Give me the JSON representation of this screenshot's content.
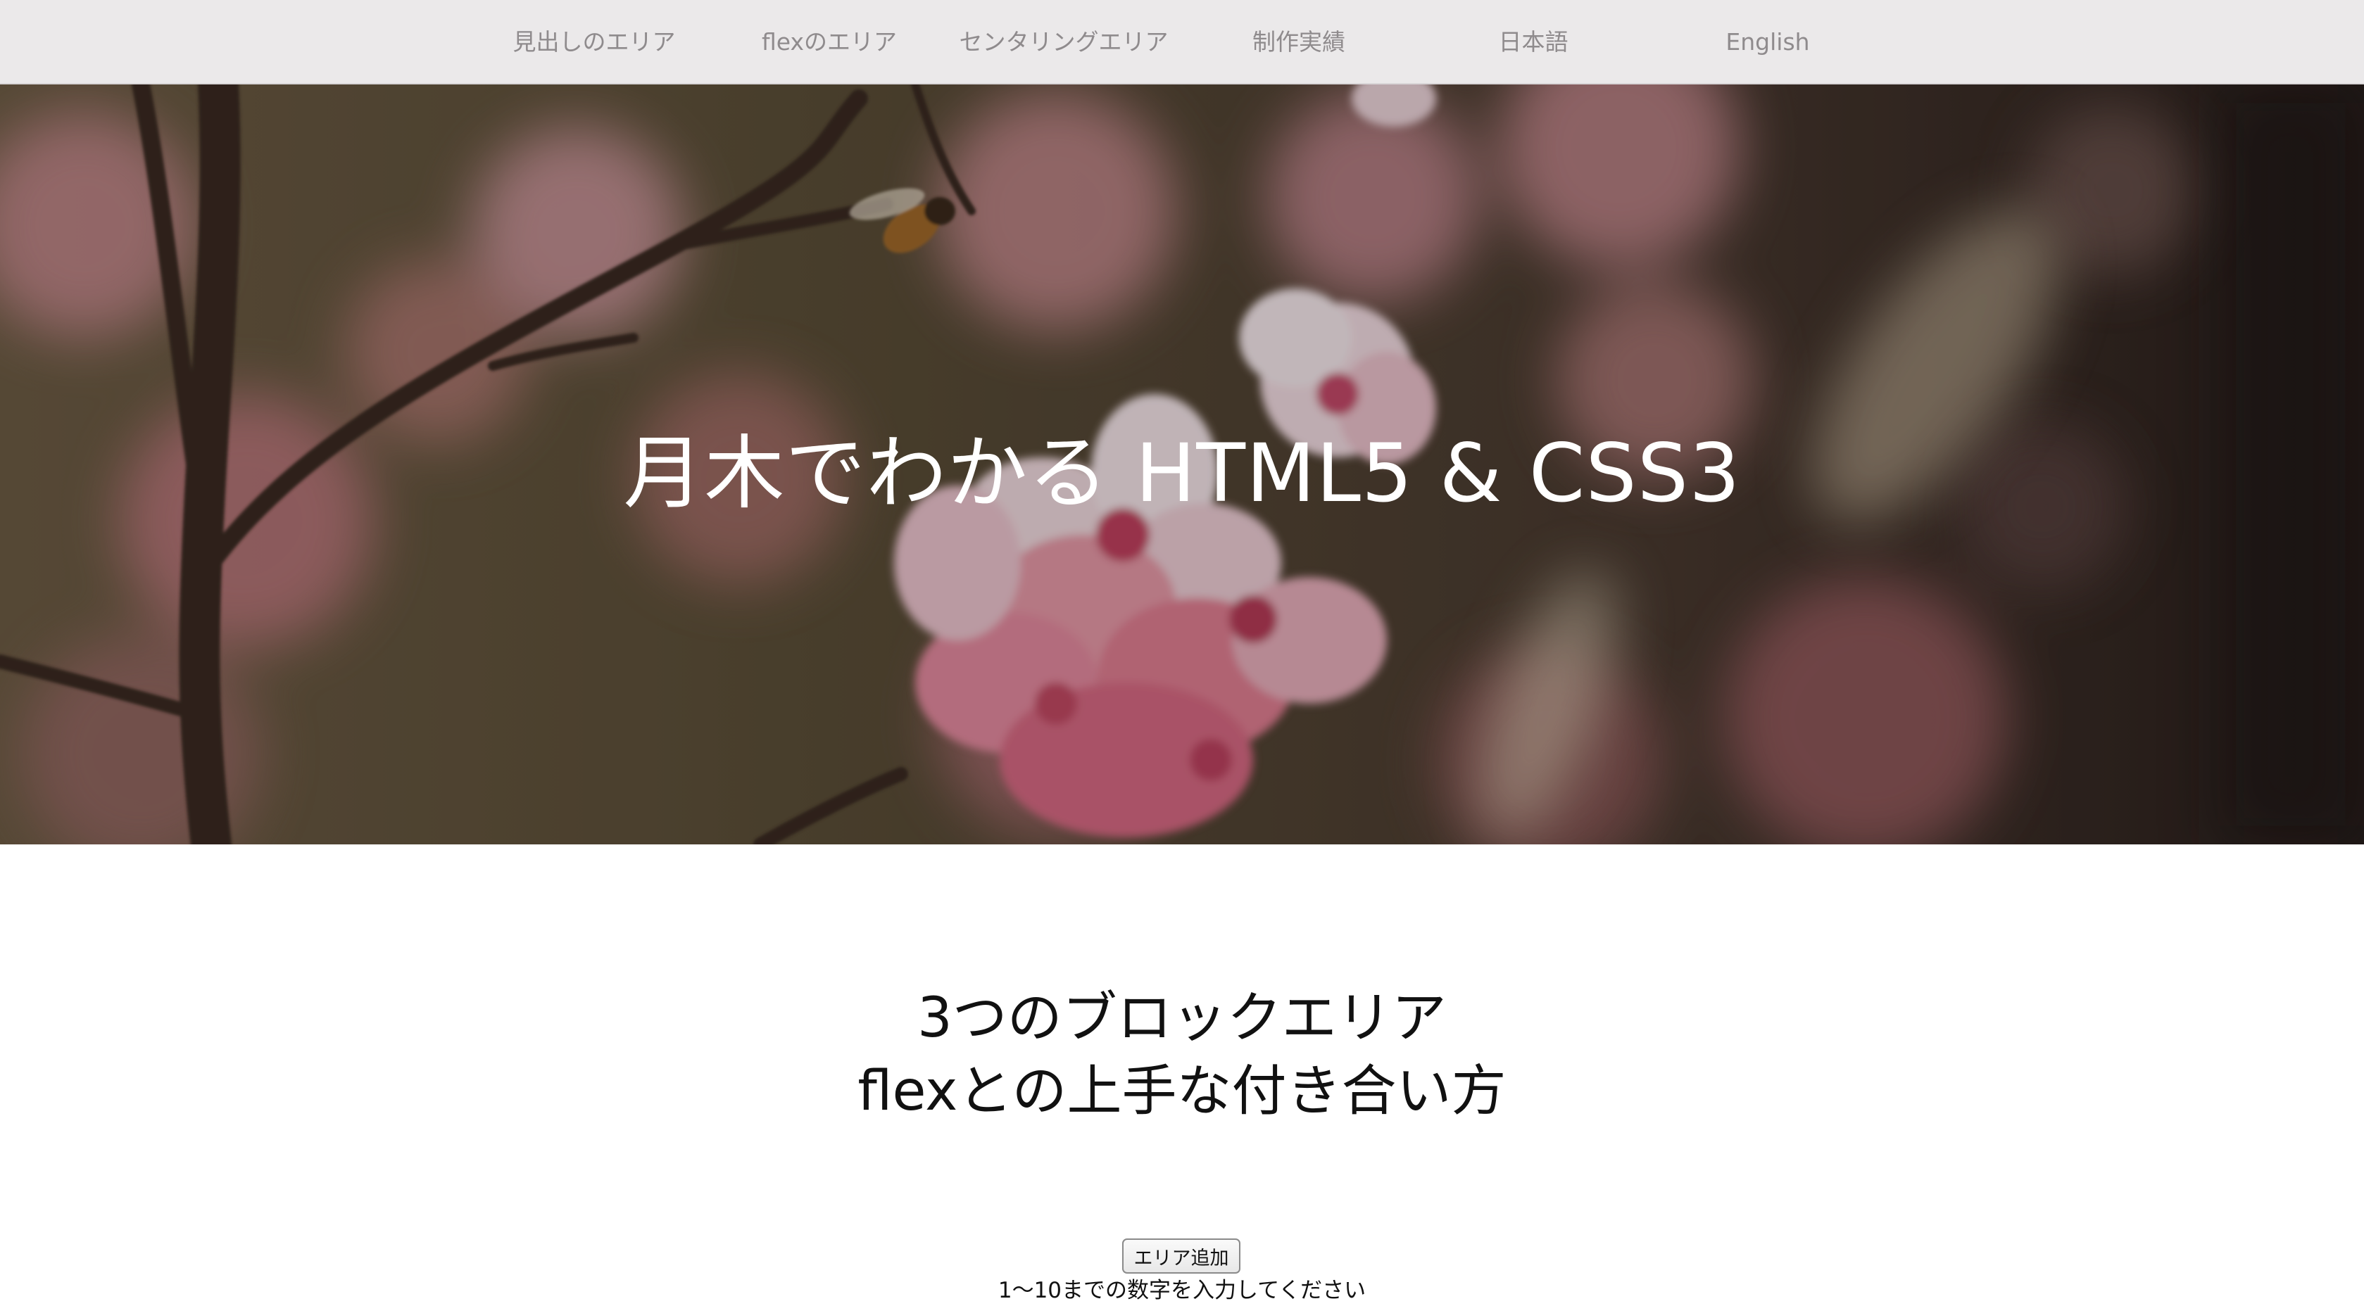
{
  "nav": {
    "items": [
      {
        "label": "見出しのエリア"
      },
      {
        "label": "flexのエリア"
      },
      {
        "label": "センタリングエリア"
      },
      {
        "label": "制作実績"
      },
      {
        "label": "日本語"
      },
      {
        "label": "English"
      }
    ]
  },
  "hero": {
    "title": "月木でわかる HTML5 & CSS3"
  },
  "section": {
    "heading_line1": "3つのブロックエリア",
    "heading_line2": "flexとの上手な付き合い方"
  },
  "controls": {
    "add_button_label": "エリア追加",
    "hint": "1〜10までの数字を入力してください"
  }
}
